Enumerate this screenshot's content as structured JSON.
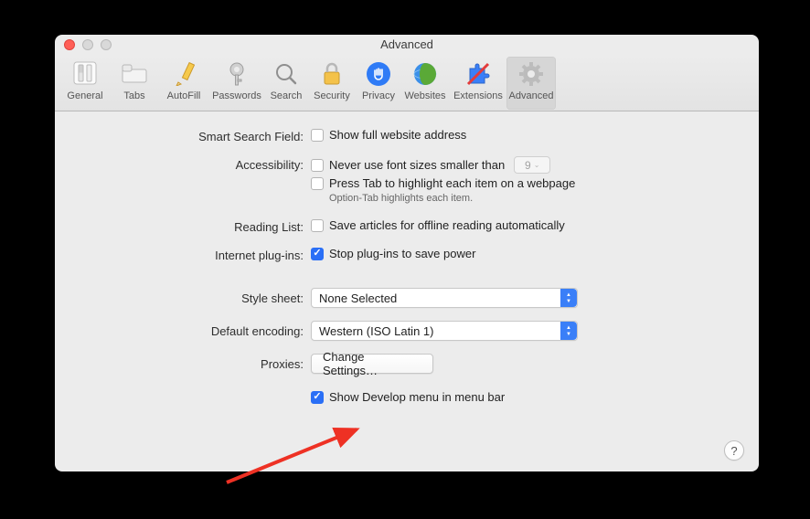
{
  "window": {
    "title": "Advanced"
  },
  "toolbar": {
    "items": [
      {
        "label": "General"
      },
      {
        "label": "Tabs"
      },
      {
        "label": "AutoFill"
      },
      {
        "label": "Passwords"
      },
      {
        "label": "Search"
      },
      {
        "label": "Security"
      },
      {
        "label": "Privacy"
      },
      {
        "label": "Websites"
      },
      {
        "label": "Extensions"
      },
      {
        "label": "Advanced"
      }
    ]
  },
  "labels": {
    "smartSearch": "Smart Search Field:",
    "accessibility": "Accessibility:",
    "readingList": "Reading List:",
    "internetPlugins": "Internet plug-ins:",
    "stylesheet": "Style sheet:",
    "defaultEncoding": "Default encoding:",
    "proxies": "Proxies:"
  },
  "options": {
    "showFullAddress": "Show full website address",
    "neverFontsSmaller": "Never use font sizes smaller than",
    "minFontSize": "9",
    "pressTab": "Press Tab to highlight each item on a webpage",
    "optionTabHint": "Option-Tab highlights each item.",
    "saveArticles": "Save articles for offline reading automatically",
    "stopPlugins": "Stop plug-ins to save power",
    "stylesheetValue": "None Selected",
    "encodingValue": "Western (ISO Latin 1)",
    "changeSettings": "Change Settings…",
    "showDevelop": "Show Develop menu in menu bar"
  },
  "help": "?"
}
